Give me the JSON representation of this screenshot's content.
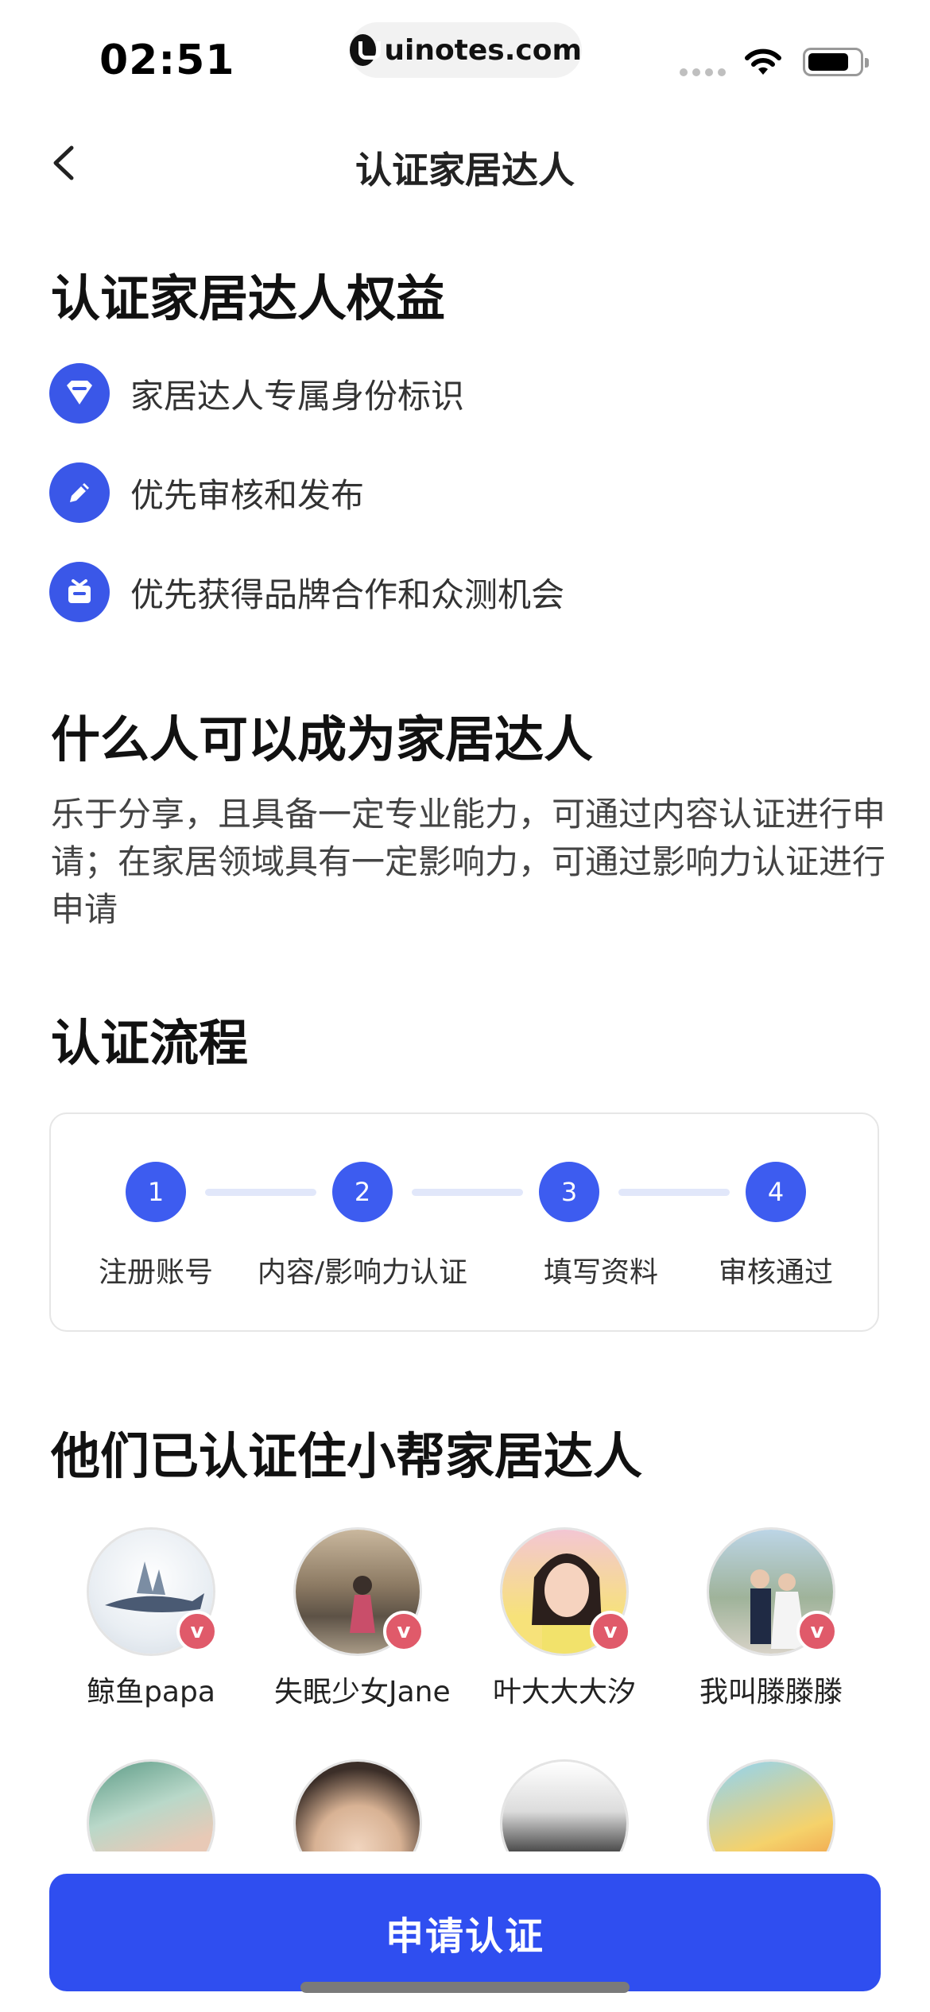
{
  "status_bar": {
    "time": "02:51",
    "url": "uinotes.com"
  },
  "nav": {
    "title": "认证家居达人"
  },
  "benefits": {
    "title": "认证家居达人权益",
    "items": [
      {
        "icon": "diamond-badge-icon",
        "label": "家居达人专属身份标识"
      },
      {
        "icon": "pencil-icon",
        "label": "优先审核和发布"
      },
      {
        "icon": "gift-box-icon",
        "label": "优先获得品牌合作和众测机会"
      }
    ]
  },
  "who": {
    "title": "什么人可以成为家居达人",
    "description": "乐于分享，且具备一定专业能力，可通过内容认证进行申请；在家居领域具有一定影响力，可通过影响力认证进行申请"
  },
  "process": {
    "title": "认证流程",
    "steps": [
      {
        "number": "1",
        "label": "注册账号"
      },
      {
        "number": "2",
        "label": "内容/影响力认证"
      },
      {
        "number": "3",
        "label": "填写资料"
      },
      {
        "number": "4",
        "label": "审核通过"
      }
    ]
  },
  "users": {
    "title": "他们已认证住小帮家居达人",
    "items": [
      {
        "name": "鲸鱼papa"
      },
      {
        "name": "失眠少女Jane"
      },
      {
        "name": "叶大大大汐"
      },
      {
        "name": "我叫滕滕滕"
      }
    ]
  },
  "verified_badge": "v",
  "apply_button": {
    "label": "申请认证"
  },
  "colors": {
    "accent": "#2f4ef0",
    "badge": "#e05a6a"
  }
}
